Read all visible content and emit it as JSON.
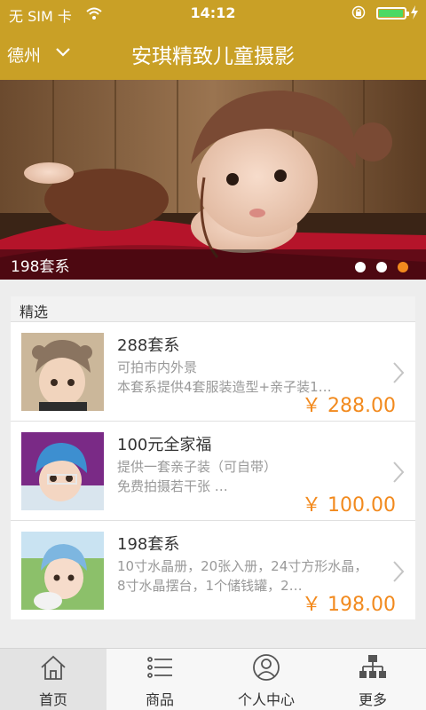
{
  "status_bar": {
    "carrier": "无 SIM 卡",
    "time": "14:12"
  },
  "header": {
    "city": "德州",
    "title": "安琪精致儿童摄影"
  },
  "banner": {
    "caption": "198套系",
    "dots": 3,
    "active_dot": 3
  },
  "section": {
    "title": "精选"
  },
  "items": [
    {
      "name": "288套系",
      "desc": "可拍市内外景\n本套系提供4套服装造型+亲子装1…",
      "price": "￥ 288.00"
    },
    {
      "name": "100元全家福",
      "desc": "提供一套亲子装（可自带）\n免费拍摄若干张 …",
      "price": "￥ 100.00"
    },
    {
      "name": "198套系",
      "desc": "10寸水晶册，20张入册，24寸方形水晶，8寸水晶摆台，1个储钱罐，2…",
      "price": "￥ 198.00"
    }
  ],
  "tabs": [
    {
      "label": "首页",
      "icon": "home-icon"
    },
    {
      "label": "商品",
      "icon": "list-icon"
    },
    {
      "label": "个人中心",
      "icon": "user-icon"
    },
    {
      "label": "更多",
      "icon": "sitemap-icon"
    }
  ],
  "colors": {
    "header_bg": "#c9a026",
    "price": "#f28a1e",
    "active_dot": "#f28a1e"
  }
}
